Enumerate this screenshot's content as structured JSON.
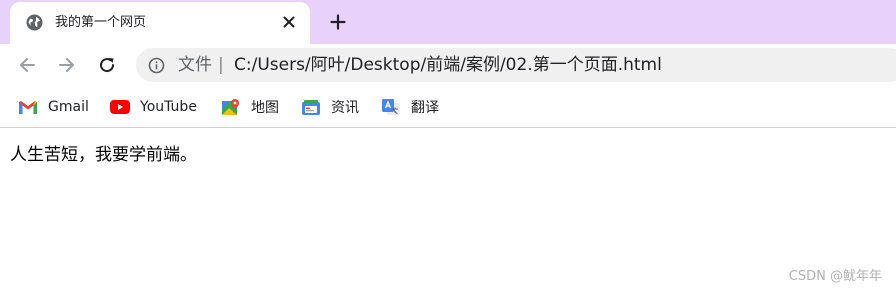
{
  "tab": {
    "title": "我的第一个网页"
  },
  "address_bar": {
    "security_label": "文件",
    "separator": "|",
    "url": "C:/Users/阿叶/Desktop/前端/案例/02.第一个页面.html"
  },
  "bookmarks": [
    {
      "label": "Gmail",
      "icon": "gmail-icon"
    },
    {
      "label": "YouTube",
      "icon": "youtube-icon"
    },
    {
      "label": "地图",
      "icon": "maps-icon"
    },
    {
      "label": "资讯",
      "icon": "news-icon"
    },
    {
      "label": "翻译",
      "icon": "translate-icon"
    }
  ],
  "page": {
    "text": "人生苦短，我要学前端。"
  },
  "watermark": "CSDN @鱿年年",
  "colors": {
    "tabstrip": "#e8d2fb",
    "omnibox": "#f0f0f1"
  }
}
